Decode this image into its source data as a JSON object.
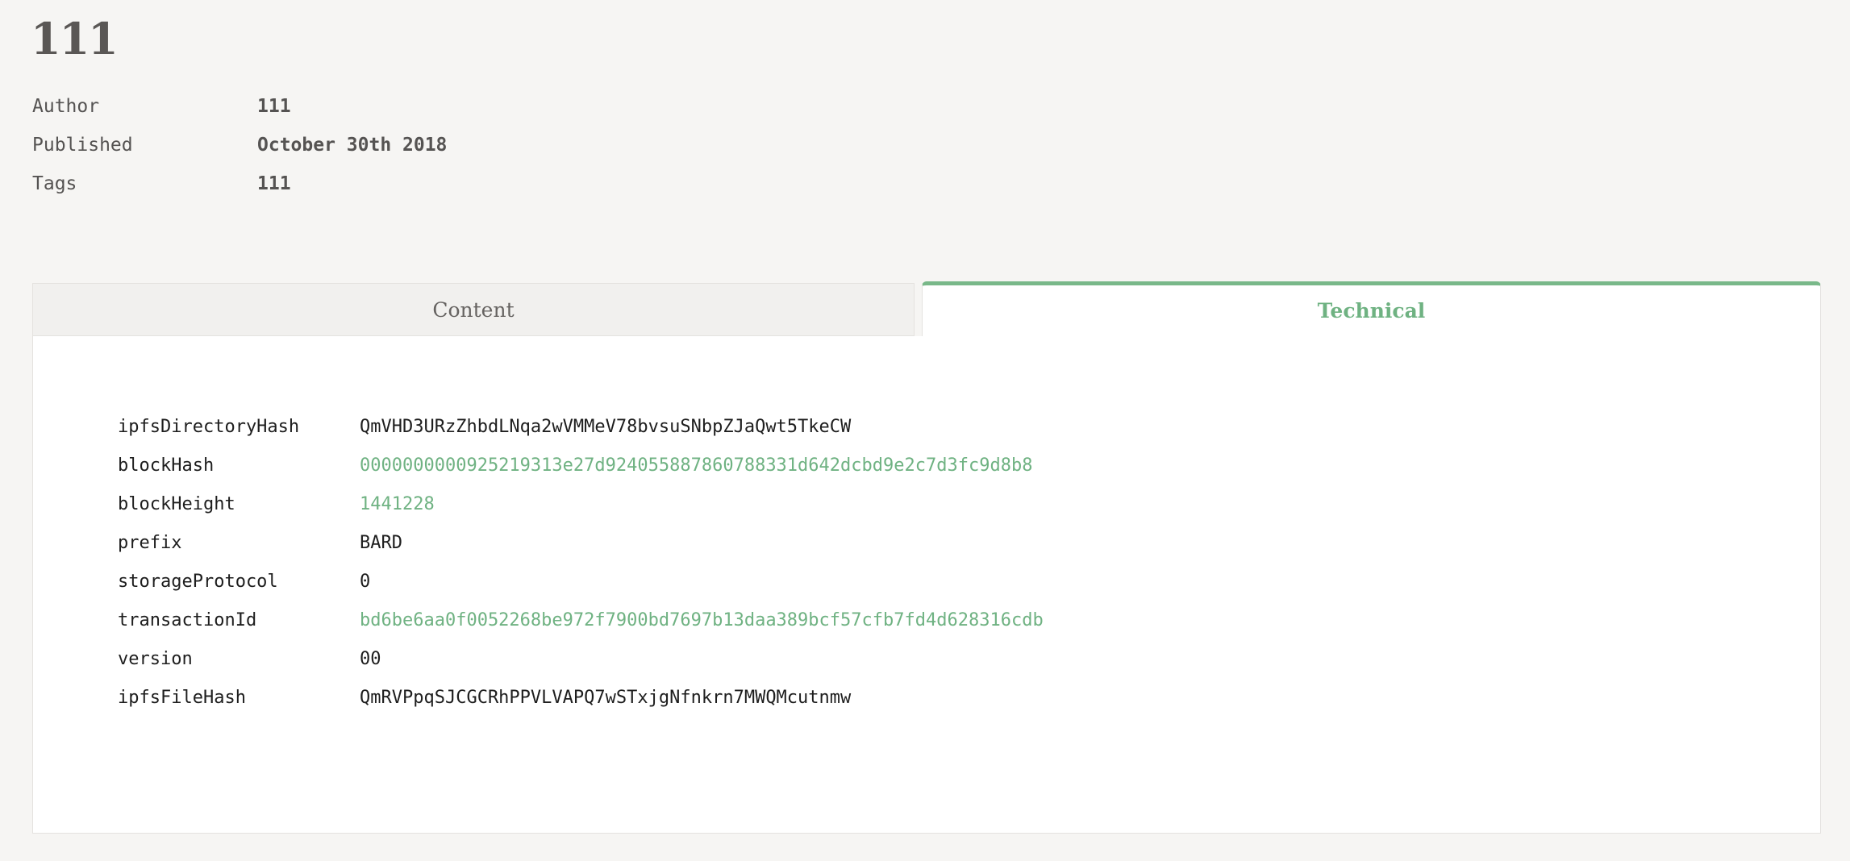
{
  "title": "111",
  "meta": [
    {
      "label": "Author",
      "value": "111"
    },
    {
      "label": "Published",
      "value": "October 30th 2018"
    },
    {
      "label": "Tags",
      "value": "111"
    }
  ],
  "tabs": {
    "content_label": "Content",
    "technical_label": "Technical",
    "active": "Technical"
  },
  "technical": [
    {
      "key": "ipfsDirectoryHash",
      "value": "QmVHD3URzZhbdLNqa2wVMMeV78bvsuSNbpZJaQwt5TkeCW",
      "link": false
    },
    {
      "key": "blockHash",
      "value": "0000000000925219313e27d924055887860788331d642dcbd9e2c7d3fc9d8b8",
      "link": true
    },
    {
      "key": "blockHeight",
      "value": "1441228",
      "link": true
    },
    {
      "key": "prefix",
      "value": "BARD",
      "link": false
    },
    {
      "key": "storageProtocol",
      "value": "0",
      "link": false
    },
    {
      "key": "transactionId",
      "value": "bd6be6aa0f0052268be972f7900bd7697b13daa389bcf57cfb7fd4d628316cdb",
      "link": true
    },
    {
      "key": "version",
      "value": "00",
      "link": false
    },
    {
      "key": "ipfsFileHash",
      "value": "QmRVPpqSJCGCRhPPVLVAPQ7wSTxjgNfnkrn7MWQMcutnmw",
      "link": false
    }
  ],
  "colors": {
    "accent": "#6fb282",
    "tab_border": "#79b889",
    "background": "#f6f5f3",
    "text": "#555352"
  }
}
